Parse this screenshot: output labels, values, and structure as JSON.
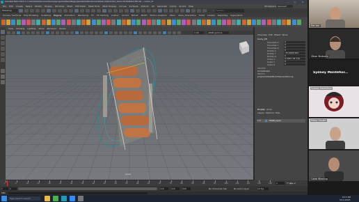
{
  "window": {
    "title": "Autodesk MAYA 2023.3: C:\\Users\\Sidd\\Documents\\maya\\projects\\default\\Rigging\\Guided\\Cabinet\\ciramat\\ball_ECJClinkdoor_Demo-TR-2026419-050.mb --- Lorem_v3",
    "menus": [
      "File",
      "Edit",
      "Create",
      "Select",
      "Modify",
      "Display",
      "Windows",
      "Mesh",
      "Edit Mesh",
      "Mesh Tools",
      "Mesh Display",
      "Curves",
      "Surfaces",
      "Deform",
      "UV",
      "Generate",
      "Cache",
      "Arnold",
      "Help"
    ],
    "workspace_label": "Workspace:",
    "workspace_value": "General*"
  },
  "modebar": {
    "mode": "Modeling",
    "search_placeholder": "Search..."
  },
  "shelf_tabs": [
    "Curves / Surfaces",
    "Poly Modeling",
    "Sculpting",
    "Rigging",
    "Animation",
    "Rendering",
    "FX",
    "FX Caching",
    "Custom",
    "Arnold",
    "Bifrost",
    "MASH",
    "Motion Graphics",
    "XGen",
    "XGen_Interactive",
    "Turtle",
    "Ldcape",
    "Rapid Rig",
    "legacyTools"
  ],
  "panel": {
    "menus": [
      "View",
      "Shading",
      "Lighting",
      "Show",
      "Renderer",
      "Panels"
    ],
    "camera_label": "persp",
    "gamma": "1.00",
    "colorspace": "sRGB gamma"
  },
  "channel_box": {
    "tabs": [
      "Channels",
      "Edit",
      "Object",
      "Show"
    ],
    "object_name": "bcuty_KB",
    "channels": [
      {
        "name": "Translate X",
        "value": "0"
      },
      {
        "name": "Translate Y",
        "value": "0"
      },
      {
        "name": "Translate Z",
        "value": "0"
      },
      {
        "name": "Rotate X",
        "value": "0"
      },
      {
        "name": "Rotate Y",
        "value": "-75.0008 502"
      },
      {
        "name": "Rotate Z",
        "value": "0"
      },
      {
        "name": "Scale X",
        "value": "0.3057 18 719"
      },
      {
        "name": "Scale Y",
        "value": "0"
      },
      {
        "name": "Scale Z",
        "value": "0"
      }
    ],
    "shapes_header": "SHAPES",
    "shape_name": "bcutyShape",
    "inputs_header": "INPUTS",
    "input_name": "polyAutoMeshBuild3GeneralGroup"
  },
  "layer_editor": {
    "tabs": [
      "Display",
      "Anim"
    ],
    "menu": [
      "Layers",
      "Options",
      "Help"
    ],
    "layer_flags": "V P",
    "layer_name": "MAIN_layer"
  },
  "time_slider": {
    "ticks": [
      "1",
      "5",
      "10",
      "15",
      "20",
      "25",
      "30",
      "35",
      "40",
      "45",
      "50",
      "55",
      "60",
      "65",
      "70",
      "75",
      "80",
      "85",
      "90",
      "95",
      "100",
      "105",
      "110",
      "115",
      "120"
    ],
    "current_frame": "1"
  },
  "range_slider": {
    "start": "1",
    "inner_start": "1",
    "inner_end": "120",
    "end": "120",
    "end2": "200",
    "fps": "24 fps",
    "char_set": "No Character Set",
    "anim_layer": "No Anim Layer"
  },
  "command_line": {
    "label": "MEL"
  },
  "zoom": {
    "participants": [
      {
        "name": "Mel Izer",
        "kind": "video"
      },
      {
        "name": "Oliver McAnally",
        "kind": "video"
      },
      {
        "name": "Sydney Montefiore",
        "kind": "name-only",
        "display": "Sydney  Montefior..."
      },
      {
        "name": "Sydney Montefiore",
        "kind": "avatar"
      },
      {
        "name": "Mikey Honam",
        "kind": "video"
      },
      {
        "name": "Caleb Winnling",
        "kind": "video"
      }
    ]
  },
  "taskbar": {
    "search_placeholder": "Type here to search",
    "clock": "8:15 PM",
    "date": "5/11/2023"
  },
  "colors": {
    "maya_bg": "#2b2b2b",
    "selection_teal": "#2e8b8b",
    "timeline_marker": "#d24444",
    "taskbar": "#1b2430"
  }
}
